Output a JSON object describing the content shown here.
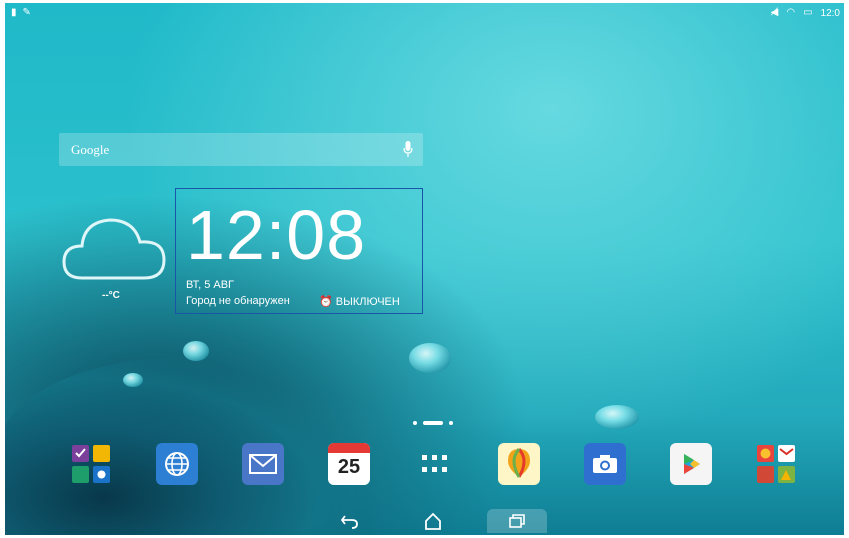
{
  "statusbar": {
    "time": "12:0",
    "left_icons": [
      "image-notification-icon",
      "tool-notification-icon"
    ],
    "right_icons": [
      "mute-icon",
      "wifi-icon",
      "battery-icon"
    ]
  },
  "search": {
    "label": "Google"
  },
  "weather": {
    "temp": "--°C"
  },
  "clock": {
    "time": "12:08",
    "date": "ВТ, 5 АВГ",
    "city": "Город не обнаружен",
    "alarm": "ВЫКЛЮЧЕН"
  },
  "dock": {
    "apps": [
      "asus-apps-folder",
      "browser",
      "email",
      "calendar",
      "app-drawer",
      "weather-app",
      "camera",
      "play-store",
      "google-folder"
    ],
    "calendar_day": "25"
  },
  "navbar": {
    "buttons": [
      "back",
      "home",
      "recents"
    ]
  },
  "colors": {
    "selection_border": "#1a56a8",
    "wallpaper": "#2cc0cc"
  }
}
